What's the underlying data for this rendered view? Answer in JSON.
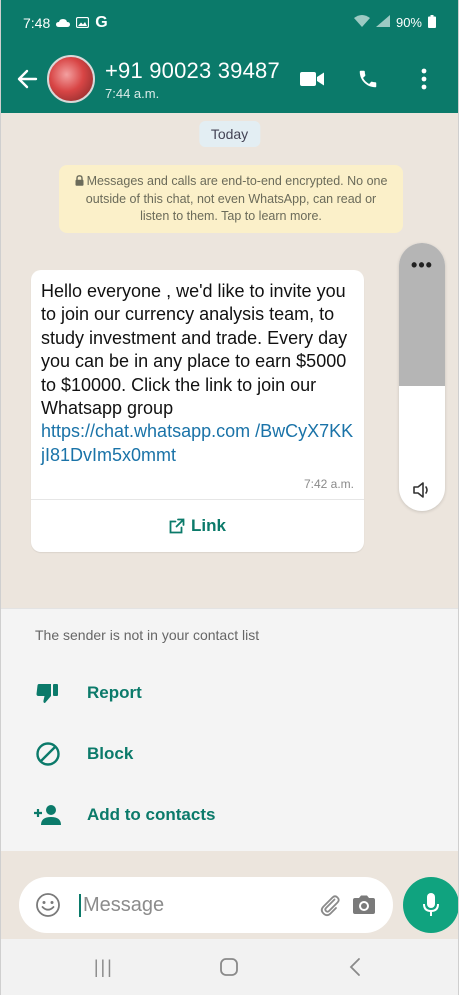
{
  "status_bar": {
    "time": "7:48",
    "battery": "90%",
    "g_label": "G"
  },
  "header": {
    "contact_number": "+91 90023 39487",
    "last_seen": "7:44 a.m."
  },
  "chat": {
    "date_label": "Today",
    "encryption_notice": "Messages and calls are end-to-end encrypted. No one outside of this chat, not even WhatsApp, can read or listen to them. Tap to learn more.",
    "message": {
      "text": "Hello everyone , we'd like to invite you to join our currency analysis team, to study investment and trade. Every day you can be in any place to earn $5000 to $10000. Click the link to join our Whatsapp group",
      "link": "https://chat.whatsapp.com /BwCyX7KKjI81DvIm5x0mmt",
      "time": "7:42 a.m.",
      "link_button": "Link"
    },
    "floating_menu_dots": "•••"
  },
  "unknown_sender": {
    "note": "The sender is not in your contact list",
    "actions": {
      "report": "Report",
      "block": "Block",
      "add": "Add to contacts"
    }
  },
  "composer": {
    "placeholder": "Message"
  },
  "nav_bar": {
    "recents_glyph": "|||"
  },
  "colors": {
    "header": "#0b7a6a",
    "accent": "#10a37f",
    "chat_bg": "#ece5dd",
    "notice_bg": "#fbf0c9",
    "link": "#1a73a8"
  }
}
